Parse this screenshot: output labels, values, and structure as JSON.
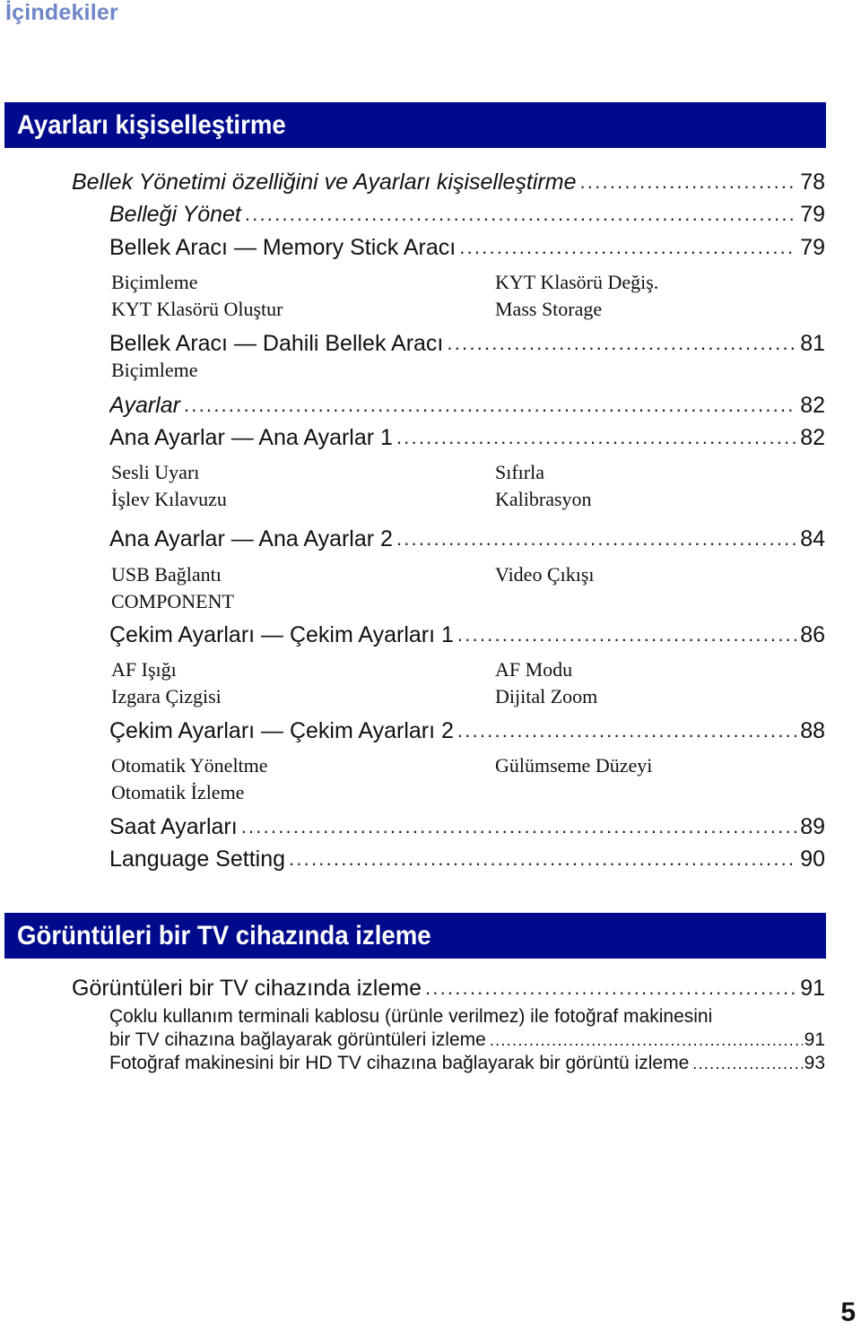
{
  "header": {
    "title": "İçindekiler"
  },
  "colors": {
    "header_text": "#6f86c8",
    "banner_bg": "#000a8c",
    "banner_text": "#ffffff"
  },
  "sections": [
    {
      "title": "Ayarları kişiselleştirme",
      "entries": [
        {
          "icon": null,
          "label": "Bellek Yönetimi özelliğini ve Ayarları kişiselleştirme",
          "italic": true,
          "page": "78"
        },
        {
          "icon": "memory-card-icon",
          "label": "Belleği Yönet",
          "italic": true,
          "page": "79"
        },
        {
          "icon": "memory-tool-icon",
          "label": "Bellek Aracı — Memory Stick Aracı",
          "italic": false,
          "page": "79",
          "subitems": [
            [
              "Biçimleme",
              "KYT Klasörü Değiş."
            ],
            [
              "KYT Klasörü Oluştur",
              "Mass Storage"
            ]
          ]
        },
        {
          "icon": "memory-tool-icon",
          "label": "Bellek Aracı — Dahili Bellek Aracı",
          "italic": false,
          "page": "81",
          "subitems": [
            [
              "Biçimleme",
              ""
            ]
          ]
        },
        {
          "icon": "toolbox-icon",
          "label": "Ayarlar",
          "italic": true,
          "page": "82"
        },
        {
          "icon": "wrench-hammer-icon",
          "label": "Ana Ayarlar — Ana Ayarlar 1",
          "italic": false,
          "page": "82",
          "subitems": [
            [
              "Sesli Uyarı",
              "Sıfırla"
            ],
            [
              "İşlev Kılavuzu",
              "Kalibrasyon"
            ]
          ]
        },
        {
          "icon": "wrench-hammer-icon",
          "label": "Ana Ayarlar — Ana Ayarlar 2",
          "italic": false,
          "page": "84",
          "subitems": [
            [
              "USB Bağlantı",
              "Video Çıkışı"
            ],
            [
              "COMPONENT",
              ""
            ]
          ]
        },
        {
          "icon": "camera-icon",
          "label": "Çekim Ayarları — Çekim Ayarları 1",
          "italic": false,
          "page": "86",
          "subitems": [
            [
              "AF Işığı",
              "AF Modu"
            ],
            [
              "Izgara Çizgisi",
              "Dijital Zoom"
            ]
          ]
        },
        {
          "icon": "camera-icon",
          "label": "Çekim Ayarları — Çekim Ayarları 2",
          "italic": false,
          "page": "88",
          "subitems": [
            [
              "Otomatik Yöneltme",
              "Gülümseme Düzeyi"
            ],
            [
              "Otomatik İzleme",
              ""
            ]
          ]
        },
        {
          "icon": "clock-icon",
          "label": "Saat Ayarları",
          "italic": false,
          "page": "89"
        },
        {
          "icon": "language-icon",
          "label": "Language Setting",
          "italic": false,
          "page": "90"
        }
      ]
    },
    {
      "title": "Görüntüleri bir TV cihazında izleme",
      "entries": [
        {
          "label": "Görüntüleri bir TV cihazında izleme",
          "page": "91"
        }
      ],
      "subentries": [
        {
          "label_line1": "Çoklu kullanım terminali kablosu (ürünle verilmez) ile fotoğraf makinesini",
          "label": "bir TV cihazına bağlayarak görüntüleri izleme",
          "page": "91"
        },
        {
          "label": "Fotoğraf makinesini bir HD TV cihazına bağlayarak bir görüntü izleme",
          "page": "93"
        }
      ]
    }
  ],
  "footer": {
    "page_number": "5"
  }
}
